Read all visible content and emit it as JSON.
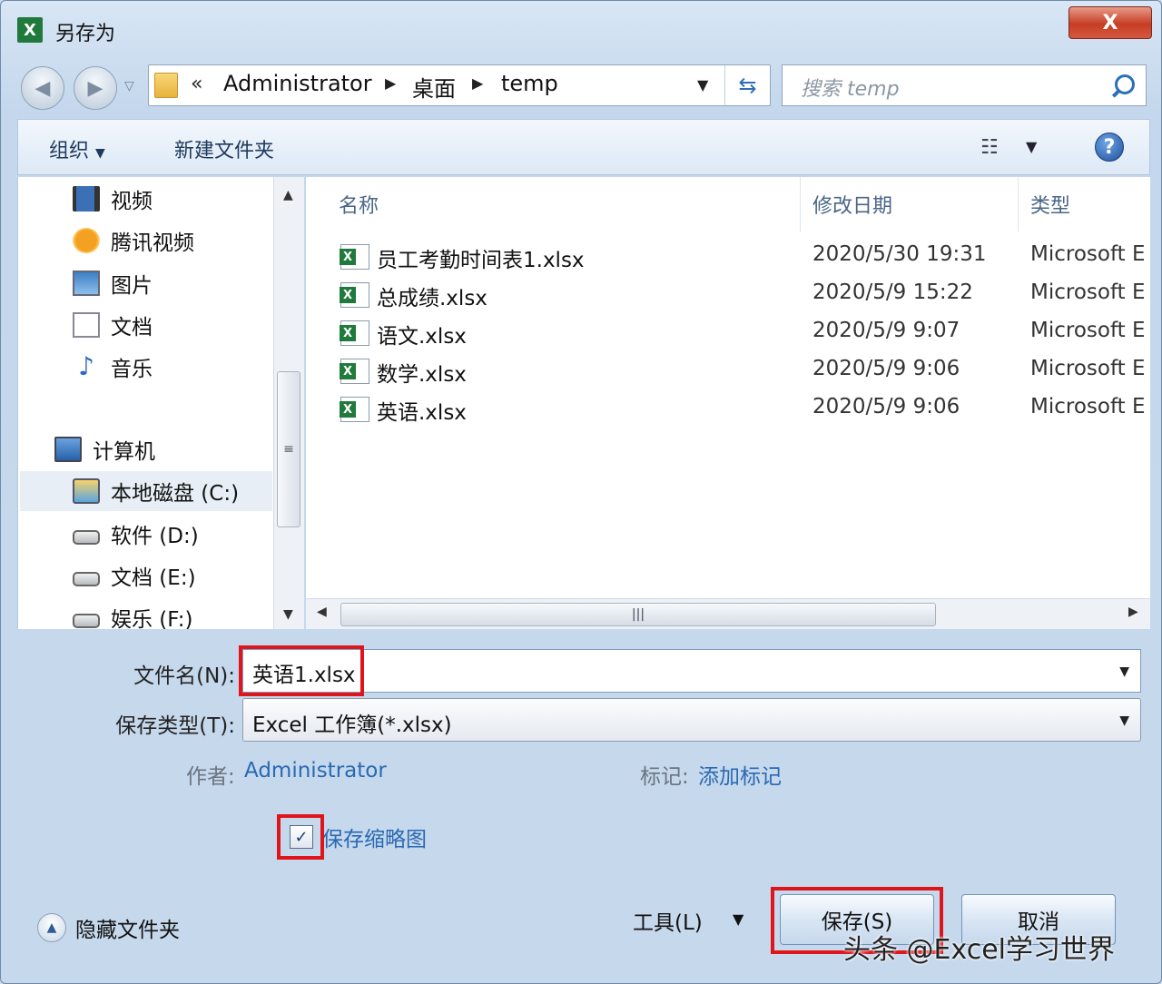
{
  "window": {
    "title": "另存为",
    "close_label": "X"
  },
  "address": {
    "overflow": "«",
    "crumbs": [
      "Administrator",
      "桌面",
      "temp"
    ],
    "search_placeholder": "搜索 temp"
  },
  "toolbar": {
    "organize": "组织",
    "new_folder": "新建文件夹"
  },
  "nav": {
    "items": [
      {
        "label": "视频"
      },
      {
        "label": "腾讯视频"
      },
      {
        "label": "图片"
      },
      {
        "label": "文档"
      },
      {
        "label": "音乐"
      },
      {
        "label": "计算机"
      },
      {
        "label": "本地磁盘 (C:)"
      },
      {
        "label": "软件 (D:)"
      },
      {
        "label": "文档 (E:)"
      },
      {
        "label": "娱乐 (F:)"
      }
    ]
  },
  "files": {
    "columns": {
      "name": "名称",
      "date": "修改日期",
      "type": "类型"
    },
    "rows": [
      {
        "name": "员工考勤时间表1.xlsx",
        "date": "2020/5/30 19:31",
        "type": "Microsoft E"
      },
      {
        "name": "总成绩.xlsx",
        "date": "2020/5/9 15:22",
        "type": "Microsoft E"
      },
      {
        "name": "语文.xlsx",
        "date": "2020/5/9 9:07",
        "type": "Microsoft E"
      },
      {
        "name": "数学.xlsx",
        "date": "2020/5/9 9:06",
        "type": "Microsoft E"
      },
      {
        "name": "英语.xlsx",
        "date": "2020/5/9 9:06",
        "type": "Microsoft E"
      }
    ]
  },
  "form": {
    "filename_label": "文件名(N):",
    "filename_value": "英语1.xlsx",
    "type_label": "保存类型(T):",
    "type_value": "Excel 工作簿(*.xlsx)",
    "author_label": "作者:",
    "author_value": "Administrator",
    "tags_label": "标记:",
    "tags_value": "添加标记",
    "thumbnail_label": "保存缩略图",
    "thumbnail_checked": true
  },
  "footer": {
    "hide_folders": "隐藏文件夹",
    "tools": "工具(L)",
    "save": "保存(S)",
    "cancel": "取消",
    "watermark": "头条 @Excel学习世界"
  },
  "colors": {
    "highlight_box": "#e0151b",
    "link": "#2a69b3",
    "excel_green": "#1f7a3c"
  }
}
